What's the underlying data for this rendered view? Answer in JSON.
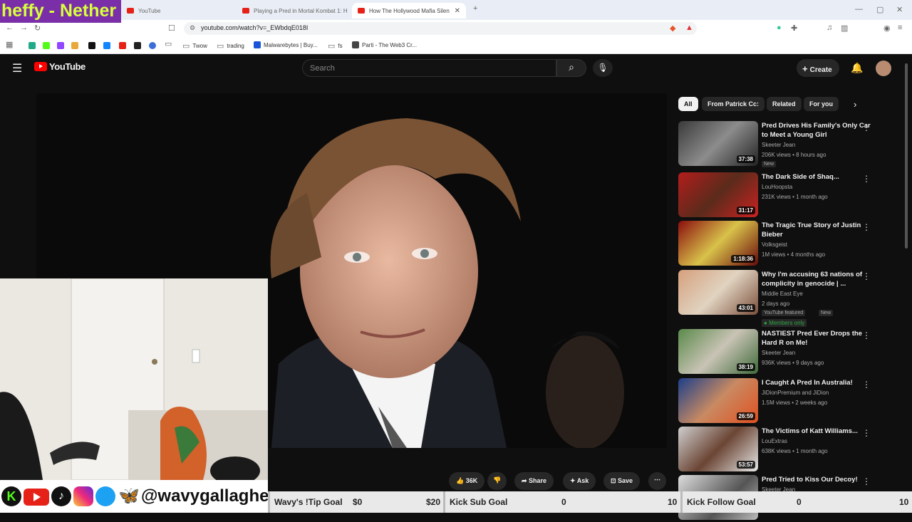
{
  "stream_overlay": {
    "title": "heffy - Nether",
    "handle": "@wavygallagher",
    "goals": [
      {
        "label": "Wavy's !Tip Goal",
        "current": "$0",
        "target": "$20"
      },
      {
        "label": "Kick Sub Goal",
        "current": "0",
        "target": "10"
      },
      {
        "label": "Kick Follow Goal",
        "current": "0",
        "target": "10"
      }
    ]
  },
  "browser": {
    "tabs": [
      {
        "label": "YouTube"
      },
      {
        "label": "Playing a Pred in Mortal Kombat 1: H"
      },
      {
        "label": "How The Hollywood Mafia Silen"
      }
    ],
    "url": "youtube.com/watch?v=_EWbdqE018I",
    "bookmarks": [
      "Twow",
      "trading",
      "Malwarebytes | Buy...",
      "fs",
      "Parti - The Web3 Cr..."
    ]
  },
  "youtube": {
    "logo": "YouTube",
    "search_placeholder": "Search",
    "create_label": "Create",
    "chips": [
      "All",
      "From Patrick Cc:",
      "Related",
      "For you"
    ],
    "actions": {
      "like": "36K",
      "share": "Share",
      "ask": "Ask",
      "save": "Save"
    },
    "recommendations": [
      {
        "title": "Pred Drives His Family's Only Car to Meet a Young Girl",
        "channel": "Skeeter Jean",
        "meta": "206K views • 8 hours ago",
        "badge": "New",
        "duration": "37:38"
      },
      {
        "title": "The Dark Side of Shaq...",
        "channel": "LouHoopsta",
        "meta": "231K views • 1 month ago",
        "duration": "31:17"
      },
      {
        "title": "The Tragic True Story of Justin Bieber",
        "channel": "Volksgeist",
        "meta": "1M views • 4 months ago",
        "duration": "1:18:36"
      },
      {
        "title": "Why I'm accusing 63 nations of complicity in genocide | ...",
        "channel": "Middle East Eye",
        "meta": "2 days ago",
        "badge": "YouTube featured",
        "badge2": "New",
        "members": "Members only",
        "duration": "43:01"
      },
      {
        "title": "NASTIEST Pred Ever Drops the Hard R on Me!",
        "channel": "Skeeter Jean",
        "meta": "936K views • 9 days ago",
        "duration": "38:19"
      },
      {
        "title": "I Caught A Pred In Australia!",
        "channel": "JiDionPremium and JiDion",
        "meta": "1.5M views • 2 weeks ago",
        "duration": "26:59"
      },
      {
        "title": "The Victims of Katt Williams...",
        "channel": "LouExtras",
        "meta": "638K views • 1 month ago",
        "duration": "53:57"
      },
      {
        "title": "Pred Tried to Kiss Our Decoy!",
        "channel": "Skeeter Jean",
        "meta": ""
      }
    ]
  }
}
